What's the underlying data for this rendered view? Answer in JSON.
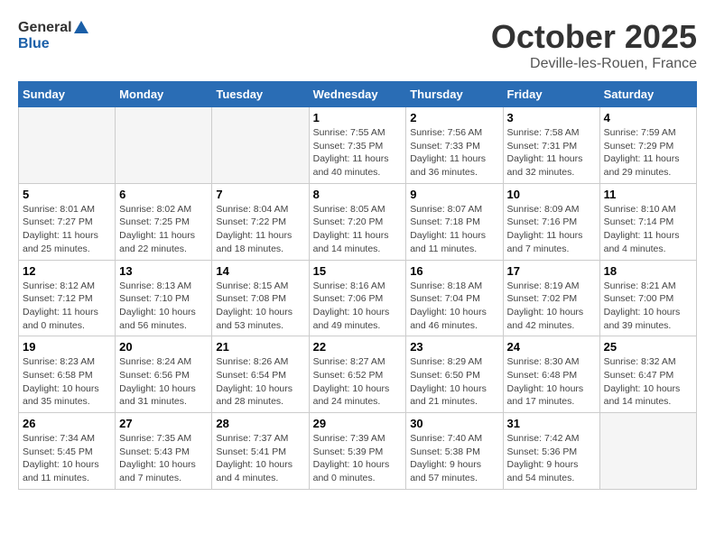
{
  "header": {
    "logo_general": "General",
    "logo_blue": "Blue",
    "month_title": "October 2025",
    "location": "Deville-les-Rouen, France"
  },
  "weekdays": [
    "Sunday",
    "Monday",
    "Tuesday",
    "Wednesday",
    "Thursday",
    "Friday",
    "Saturday"
  ],
  "weeks": [
    [
      {
        "day": "",
        "info": ""
      },
      {
        "day": "",
        "info": ""
      },
      {
        "day": "",
        "info": ""
      },
      {
        "day": "1",
        "info": "Sunrise: 7:55 AM\nSunset: 7:35 PM\nDaylight: 11 hours\nand 40 minutes."
      },
      {
        "day": "2",
        "info": "Sunrise: 7:56 AM\nSunset: 7:33 PM\nDaylight: 11 hours\nand 36 minutes."
      },
      {
        "day": "3",
        "info": "Sunrise: 7:58 AM\nSunset: 7:31 PM\nDaylight: 11 hours\nand 32 minutes."
      },
      {
        "day": "4",
        "info": "Sunrise: 7:59 AM\nSunset: 7:29 PM\nDaylight: 11 hours\nand 29 minutes."
      }
    ],
    [
      {
        "day": "5",
        "info": "Sunrise: 8:01 AM\nSunset: 7:27 PM\nDaylight: 11 hours\nand 25 minutes."
      },
      {
        "day": "6",
        "info": "Sunrise: 8:02 AM\nSunset: 7:25 PM\nDaylight: 11 hours\nand 22 minutes."
      },
      {
        "day": "7",
        "info": "Sunrise: 8:04 AM\nSunset: 7:22 PM\nDaylight: 11 hours\nand 18 minutes."
      },
      {
        "day": "8",
        "info": "Sunrise: 8:05 AM\nSunset: 7:20 PM\nDaylight: 11 hours\nand 14 minutes."
      },
      {
        "day": "9",
        "info": "Sunrise: 8:07 AM\nSunset: 7:18 PM\nDaylight: 11 hours\nand 11 minutes."
      },
      {
        "day": "10",
        "info": "Sunrise: 8:09 AM\nSunset: 7:16 PM\nDaylight: 11 hours\nand 7 minutes."
      },
      {
        "day": "11",
        "info": "Sunrise: 8:10 AM\nSunset: 7:14 PM\nDaylight: 11 hours\nand 4 minutes."
      }
    ],
    [
      {
        "day": "12",
        "info": "Sunrise: 8:12 AM\nSunset: 7:12 PM\nDaylight: 11 hours\nand 0 minutes."
      },
      {
        "day": "13",
        "info": "Sunrise: 8:13 AM\nSunset: 7:10 PM\nDaylight: 10 hours\nand 56 minutes."
      },
      {
        "day": "14",
        "info": "Sunrise: 8:15 AM\nSunset: 7:08 PM\nDaylight: 10 hours\nand 53 minutes."
      },
      {
        "day": "15",
        "info": "Sunrise: 8:16 AM\nSunset: 7:06 PM\nDaylight: 10 hours\nand 49 minutes."
      },
      {
        "day": "16",
        "info": "Sunrise: 8:18 AM\nSunset: 7:04 PM\nDaylight: 10 hours\nand 46 minutes."
      },
      {
        "day": "17",
        "info": "Sunrise: 8:19 AM\nSunset: 7:02 PM\nDaylight: 10 hours\nand 42 minutes."
      },
      {
        "day": "18",
        "info": "Sunrise: 8:21 AM\nSunset: 7:00 PM\nDaylight: 10 hours\nand 39 minutes."
      }
    ],
    [
      {
        "day": "19",
        "info": "Sunrise: 8:23 AM\nSunset: 6:58 PM\nDaylight: 10 hours\nand 35 minutes."
      },
      {
        "day": "20",
        "info": "Sunrise: 8:24 AM\nSunset: 6:56 PM\nDaylight: 10 hours\nand 31 minutes."
      },
      {
        "day": "21",
        "info": "Sunrise: 8:26 AM\nSunset: 6:54 PM\nDaylight: 10 hours\nand 28 minutes."
      },
      {
        "day": "22",
        "info": "Sunrise: 8:27 AM\nSunset: 6:52 PM\nDaylight: 10 hours\nand 24 minutes."
      },
      {
        "day": "23",
        "info": "Sunrise: 8:29 AM\nSunset: 6:50 PM\nDaylight: 10 hours\nand 21 minutes."
      },
      {
        "day": "24",
        "info": "Sunrise: 8:30 AM\nSunset: 6:48 PM\nDaylight: 10 hours\nand 17 minutes."
      },
      {
        "day": "25",
        "info": "Sunrise: 8:32 AM\nSunset: 6:47 PM\nDaylight: 10 hours\nand 14 minutes."
      }
    ],
    [
      {
        "day": "26",
        "info": "Sunrise: 7:34 AM\nSunset: 5:45 PM\nDaylight: 10 hours\nand 11 minutes."
      },
      {
        "day": "27",
        "info": "Sunrise: 7:35 AM\nSunset: 5:43 PM\nDaylight: 10 hours\nand 7 minutes."
      },
      {
        "day": "28",
        "info": "Sunrise: 7:37 AM\nSunset: 5:41 PM\nDaylight: 10 hours\nand 4 minutes."
      },
      {
        "day": "29",
        "info": "Sunrise: 7:39 AM\nSunset: 5:39 PM\nDaylight: 10 hours\nand 0 minutes."
      },
      {
        "day": "30",
        "info": "Sunrise: 7:40 AM\nSunset: 5:38 PM\nDaylight: 9 hours\nand 57 minutes."
      },
      {
        "day": "31",
        "info": "Sunrise: 7:42 AM\nSunset: 5:36 PM\nDaylight: 9 hours\nand 54 minutes."
      },
      {
        "day": "",
        "info": ""
      }
    ]
  ]
}
